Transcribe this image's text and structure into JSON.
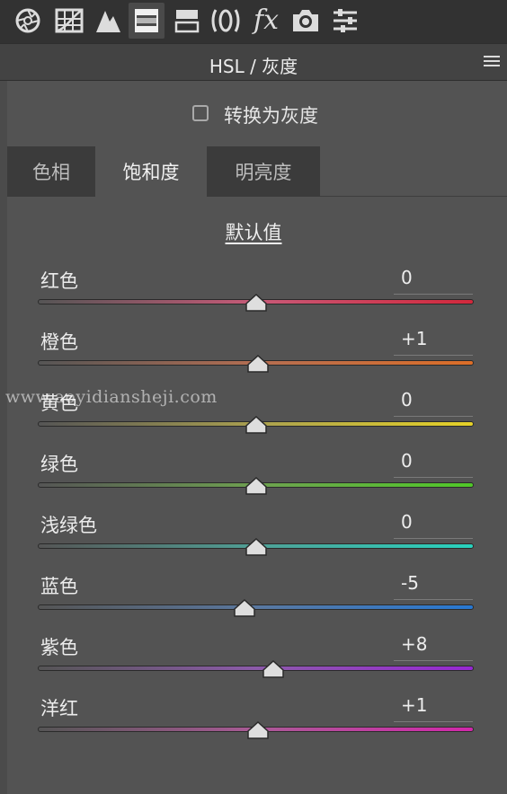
{
  "toolbar": {
    "tools": [
      {
        "icon": "aperture-icon",
        "active": false
      },
      {
        "icon": "curve-grid-icon",
        "active": false
      },
      {
        "icon": "detail-triangle-icon",
        "active": false
      },
      {
        "icon": "hsl-grayscale-icon",
        "active": true
      },
      {
        "icon": "split-toning-icon",
        "active": false
      },
      {
        "icon": "lens-corrections-icon",
        "active": false
      },
      {
        "icon": "fx-icon",
        "active": false
      },
      {
        "icon": "camera-calibration-icon",
        "active": false
      },
      {
        "icon": "presets-sliders-icon",
        "active": false
      }
    ],
    "fx_text": "fx"
  },
  "panel": {
    "title": "HSL / 灰度",
    "convert_grayscale_label": "转换为灰度",
    "convert_grayscale_checked": false,
    "tabs": [
      {
        "label": "色相",
        "active": false
      },
      {
        "label": "饱和度",
        "active": true
      },
      {
        "label": "明亮度",
        "active": false
      }
    ],
    "default_link": "默认值"
  },
  "sliders": [
    {
      "label": "红色",
      "value": "0",
      "numeric": 0,
      "colors": [
        "#555555",
        "#c85a78",
        "#d2283c"
      ]
    },
    {
      "label": "橙色",
      "value": "+1",
      "numeric": 1,
      "colors": [
        "#555555",
        "#b46e52",
        "#dc6e28"
      ]
    },
    {
      "label": "黄色",
      "value": "0",
      "numeric": 0,
      "colors": [
        "#555555",
        "#aaa050",
        "#e6d228"
      ]
    },
    {
      "label": "绿色",
      "value": "0",
      "numeric": 0,
      "colors": [
        "#555555",
        "#6ea050",
        "#50c828"
      ]
    },
    {
      "label": "浅绿色",
      "value": "0",
      "numeric": 0,
      "colors": [
        "#555555",
        "#50a096",
        "#28d2be"
      ]
    },
    {
      "label": "蓝色",
      "value": "-5",
      "numeric": -5,
      "colors": [
        "#555555",
        "#5a78a0",
        "#2878d2"
      ]
    },
    {
      "label": "紫色",
      "value": "+8",
      "numeric": 8,
      "colors": [
        "#555555",
        "#8c5aaa",
        "#9628d2"
      ]
    },
    {
      "label": "洋红",
      "value": "+1",
      "numeric": 1,
      "colors": [
        "#555555",
        "#aa5a96",
        "#d228aa"
      ]
    }
  ],
  "slider_range": [
    -100,
    100
  ],
  "watermark": "www.aoyidiansheji.com"
}
